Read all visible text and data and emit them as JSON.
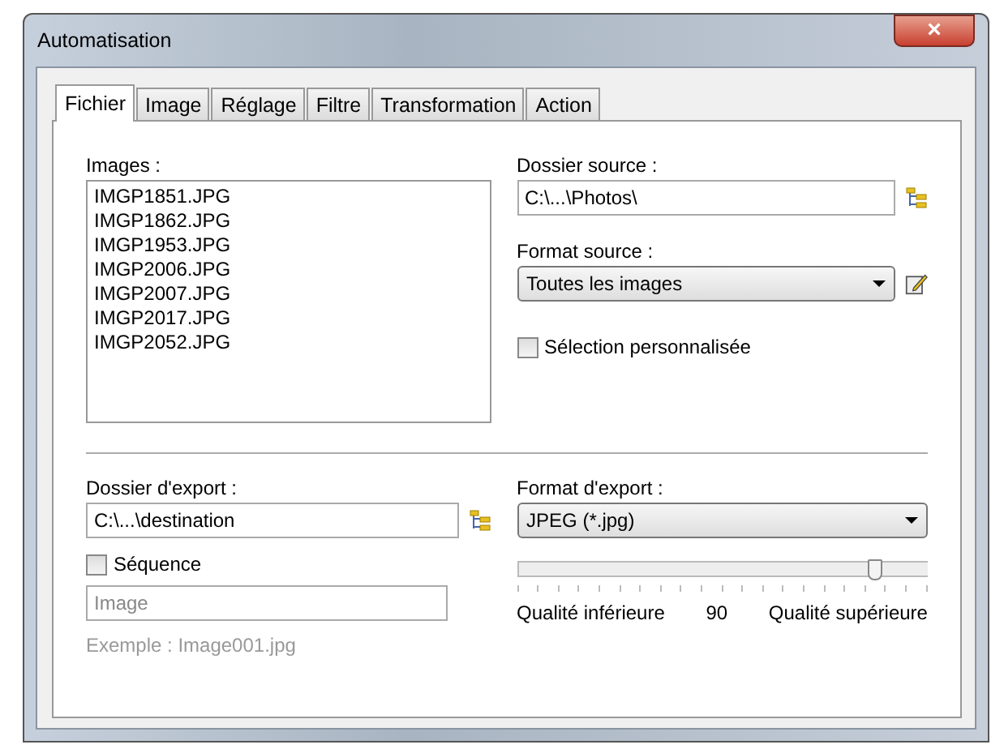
{
  "window": {
    "title": "Automatisation",
    "close": "×"
  },
  "tabs": [
    {
      "label": "Fichier",
      "selected": true
    },
    {
      "label": "Image",
      "selected": false
    },
    {
      "label": "Réglage",
      "selected": false
    },
    {
      "label": "Filtre",
      "selected": false
    },
    {
      "label": "Transformation",
      "selected": false
    },
    {
      "label": "Action",
      "selected": false
    }
  ],
  "images": {
    "label": "Images :",
    "files": [
      "IMGP1851.JPG",
      "IMGP1862.JPG",
      "IMGP1953.JPG",
      "IMGP2006.JPG",
      "IMGP2007.JPG",
      "IMGP2017.JPG",
      "IMGP2052.JPG"
    ]
  },
  "source_folder": {
    "label": "Dossier source :",
    "value": "C:\\...\\Photos\\"
  },
  "source_format": {
    "label": "Format source :",
    "value": "Toutes les images"
  },
  "custom_selection": {
    "label": "Sélection personnalisée",
    "checked": false
  },
  "export_folder": {
    "label": "Dossier d'export :",
    "value": "C:\\...\\destination"
  },
  "sequence": {
    "label": "Séquence",
    "checked": false,
    "placeholder": "Image",
    "example": "Exemple : Image001.jpg"
  },
  "export_format": {
    "label": "Format d'export :",
    "value": "JPEG (*.jpg)"
  },
  "quality": {
    "level": 0.87,
    "min_label": "Qualité inférieure",
    "reading": "90",
    "max_label": "Qualité supérieure"
  }
}
